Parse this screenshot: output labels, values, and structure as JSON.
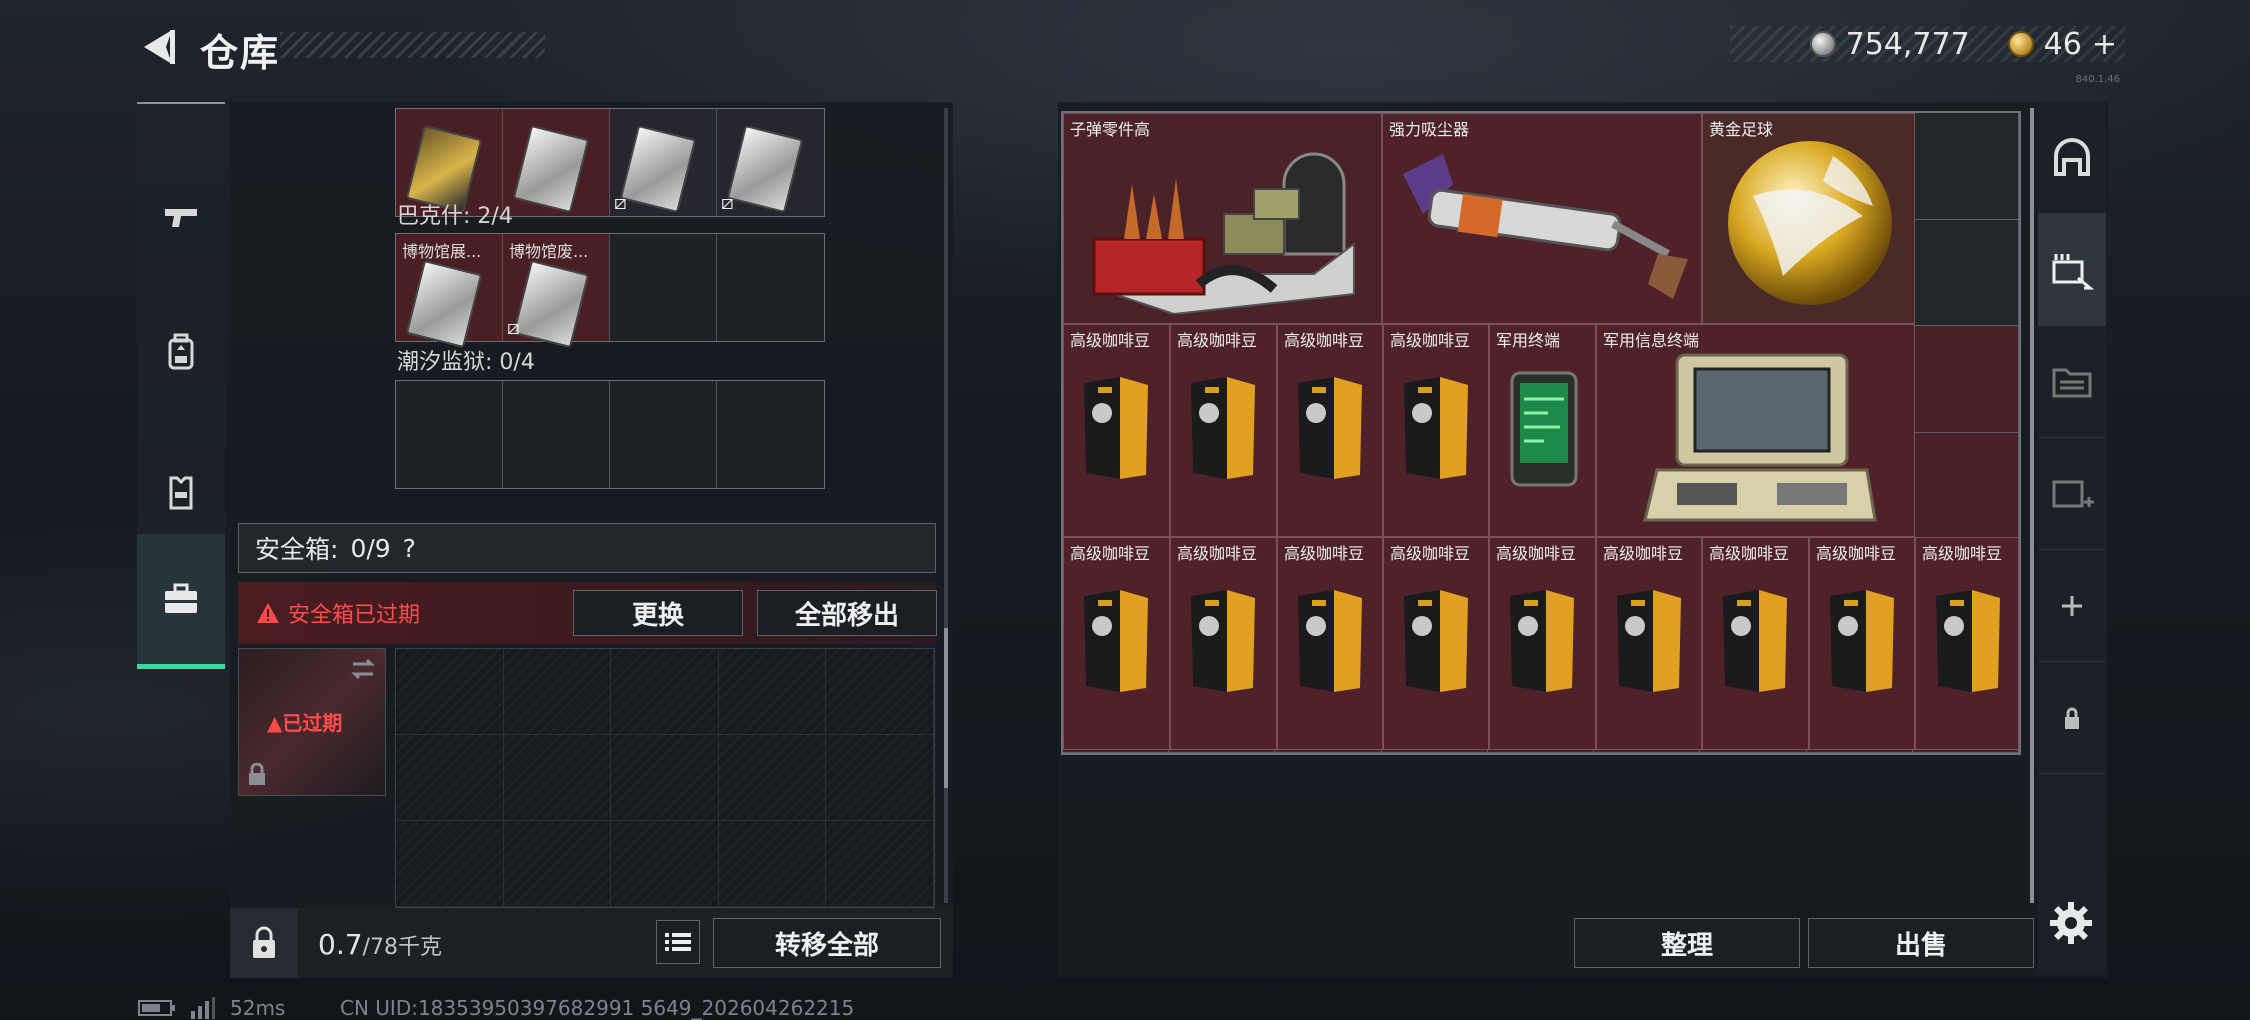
{
  "header": {
    "title": "仓库",
    "currency_silver": "754,777",
    "currency_gold": "46",
    "gold_plus": "+",
    "version": "840.1.46"
  },
  "left": {
    "tabs": [
      "pistol-icon",
      "backpack-icon",
      "vest-icon",
      "briefcase-icon"
    ],
    "row0": [
      {
        "label": "",
        "style": "red"
      },
      {
        "label": "",
        "style": "red"
      },
      {
        "label": "",
        "style": "dark"
      },
      {
        "label": "",
        "style": "dark"
      }
    ],
    "section_bakeshen": "巴克什: 2/4",
    "row1": [
      {
        "label": "博物馆展..."
      },
      {
        "label": "博物馆废..."
      }
    ],
    "section_chaoxi": "潮汐监狱: 0/4",
    "safe_title": "安全箱:",
    "safe_count": "0/9",
    "safe_help": "?",
    "expired_msg": "安全箱已过期",
    "replace_btn": "更换",
    "move_all_btn": "全部移出",
    "safe_box_status": "已过期",
    "weight_value": "0.7",
    "weight_total": "/78千克",
    "transfer_all_btn": "转移全部"
  },
  "right": {
    "items": {
      "ammo_box": "子弹零件高",
      "vacuum": "强力吸尘器",
      "gold_ball": "黄金足球",
      "military_terminal": "军用终端",
      "military_info_terminal": "军用信息终端",
      "coffee": "高级咖啡豆"
    },
    "organize_btn": "整理",
    "sell_btn": "出售",
    "side_tabs": [
      "stash-arch-icon",
      "item-transfer-icon",
      "folder-icon",
      "add-container-icon",
      "plus-icon",
      "lock-icon"
    ]
  },
  "status": {
    "ping": "52ms",
    "uid": "CN UID:18353950397682991 5649_202604262215"
  }
}
